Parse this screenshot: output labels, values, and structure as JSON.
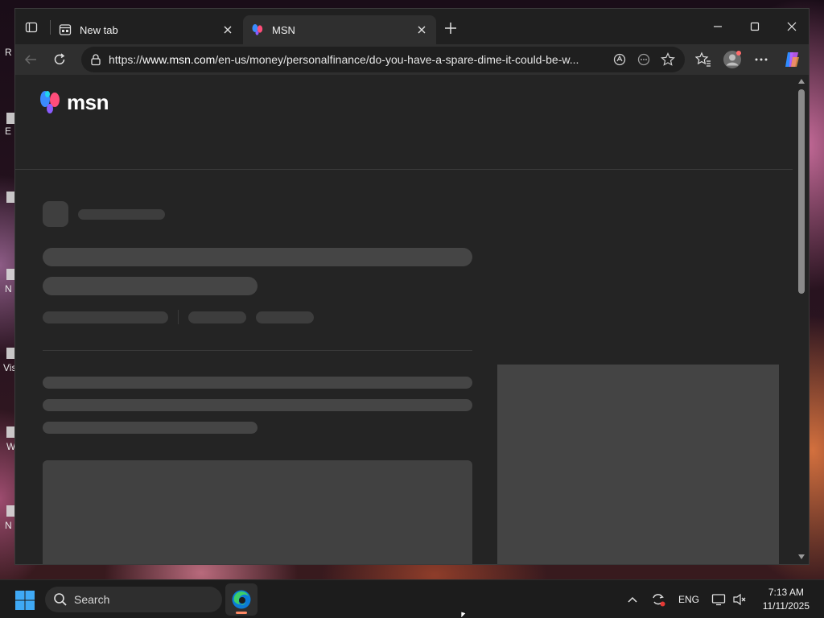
{
  "desktop": {
    "icon_labels": [
      "R",
      "E",
      "N",
      "Vis",
      "W",
      "N"
    ]
  },
  "browser": {
    "tabs": [
      {
        "title": "New tab",
        "icon": "new-tab-page-icon",
        "active": false
      },
      {
        "title": "MSN",
        "icon": "msn-butterfly-icon",
        "active": true
      }
    ],
    "address": {
      "url_prefix": "https://",
      "url_host": "www.msn.com",
      "url_path": "/en-us/money/personalfinance/do-you-have-a-spare-dime-it-could-be-w..."
    },
    "toolbar_icons": [
      "back-icon",
      "refresh-icon",
      "lock-icon",
      "read-aloud-icon",
      "more-tools-icon",
      "favorite-star-icon",
      "favorites-icon",
      "profile-icon",
      "menu-icon",
      "copilot-icon"
    ]
  },
  "page": {
    "logo_text": "msn",
    "state": "loading-skeleton"
  },
  "taskbar": {
    "search_placeholder": "Search",
    "language": "ENG",
    "time": "7:13 AM",
    "date": "11/11/2025"
  },
  "colors": {
    "window_bg": "#202020",
    "toolbar_bg": "#2f2f2f",
    "page_bg": "#242424",
    "skeleton": "#3d3d3d",
    "taskbar_bg": "#1c1c1c",
    "edge_indicator": "#ff8a65"
  }
}
